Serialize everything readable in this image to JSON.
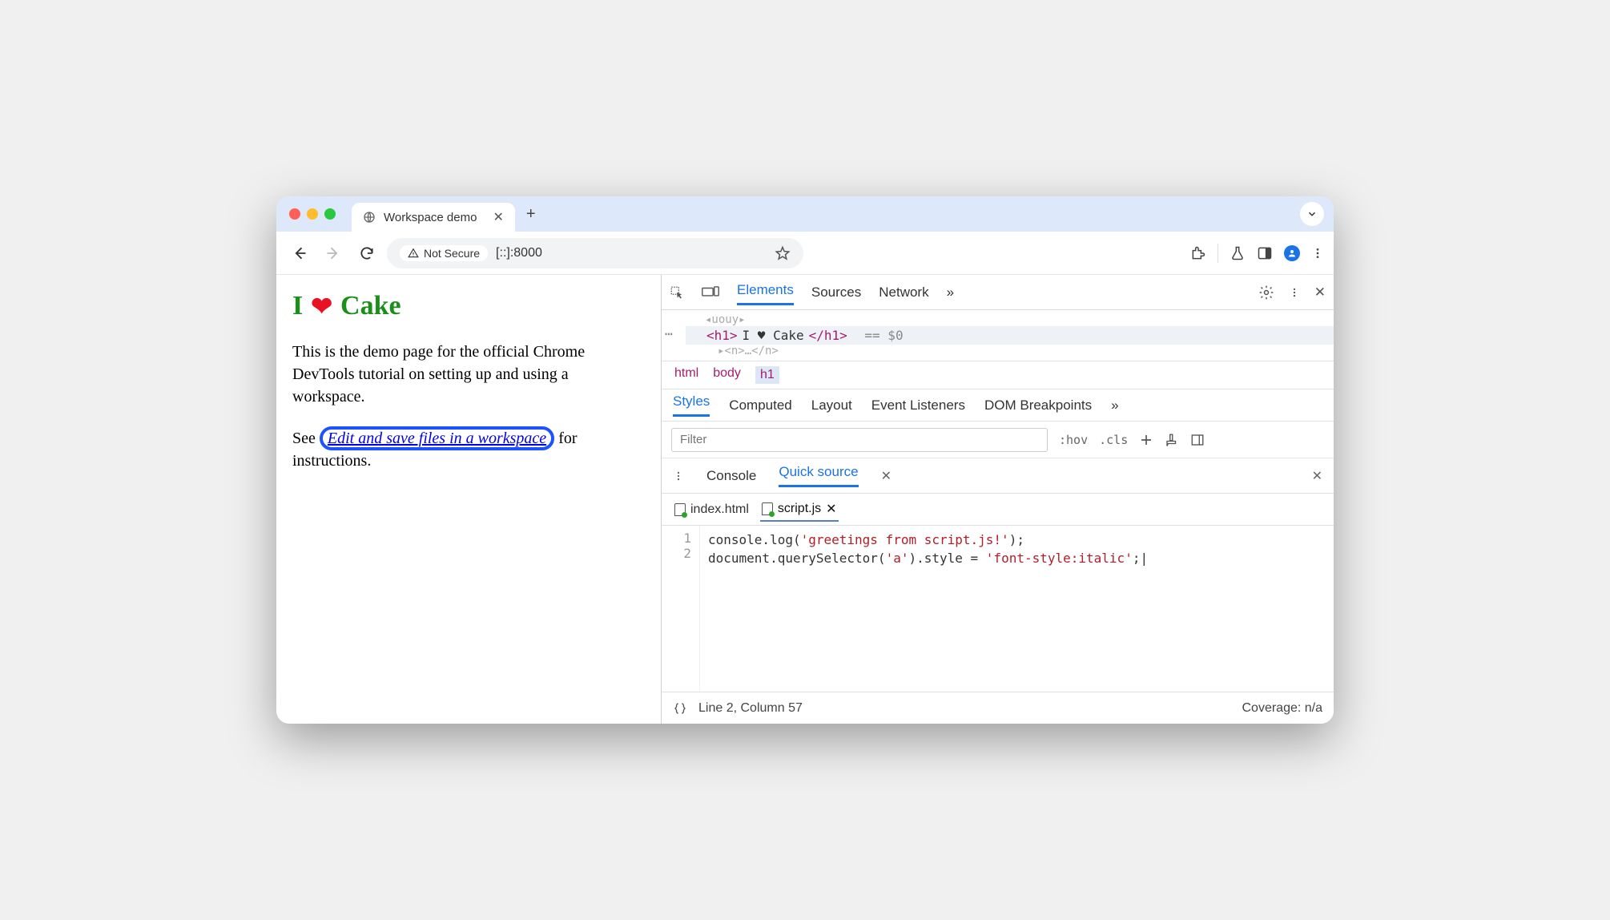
{
  "window": {
    "tab_title": "Workspace demo",
    "new_tab_plus": "+"
  },
  "toolbar": {
    "security_label": "Not Secure",
    "url": "[::]:8000"
  },
  "page": {
    "heading_pre": "I",
    "heading_heart": "❤",
    "heading_post": "Cake",
    "para1": "This is the demo page for the official Chrome DevTools tutorial on setting up and using a workspace.",
    "para2_pre": "See ",
    "para2_link": "Edit and save files in a workspace",
    "para2_post": " for instructions."
  },
  "devtools": {
    "tabs": {
      "elements": "Elements",
      "sources": "Sources",
      "network": "Network",
      "more": "»"
    },
    "dom": {
      "body_open_faded": "◂uouy▸",
      "h1_open": "<h1>",
      "h1_text": "I ♥ Cake",
      "h1_close": "</h1>",
      "equals": "== $0",
      "next_faded": "▸<n>…</n>"
    },
    "crumbs": {
      "html": "html",
      "body": "body",
      "h1": "h1"
    },
    "styles_tabs": {
      "styles": "Styles",
      "computed": "Computed",
      "layout": "Layout",
      "event": "Event Listeners",
      "dom": "DOM Breakpoints",
      "more": "»"
    },
    "filter": {
      "placeholder": "Filter",
      "hov": ":hov",
      "cls": ".cls"
    },
    "drawer": {
      "console": "Console",
      "quick": "Quick source"
    },
    "files": {
      "a": "index.html",
      "b": "script.js"
    },
    "code": {
      "l1": "console.log('greetings from script.js!');",
      "l2": "document.querySelector('a').style = 'font-style:italic';",
      "n1": "1",
      "n2": "2"
    },
    "status": {
      "pos": "Line 2, Column 57",
      "coverage": "Coverage: n/a"
    }
  }
}
